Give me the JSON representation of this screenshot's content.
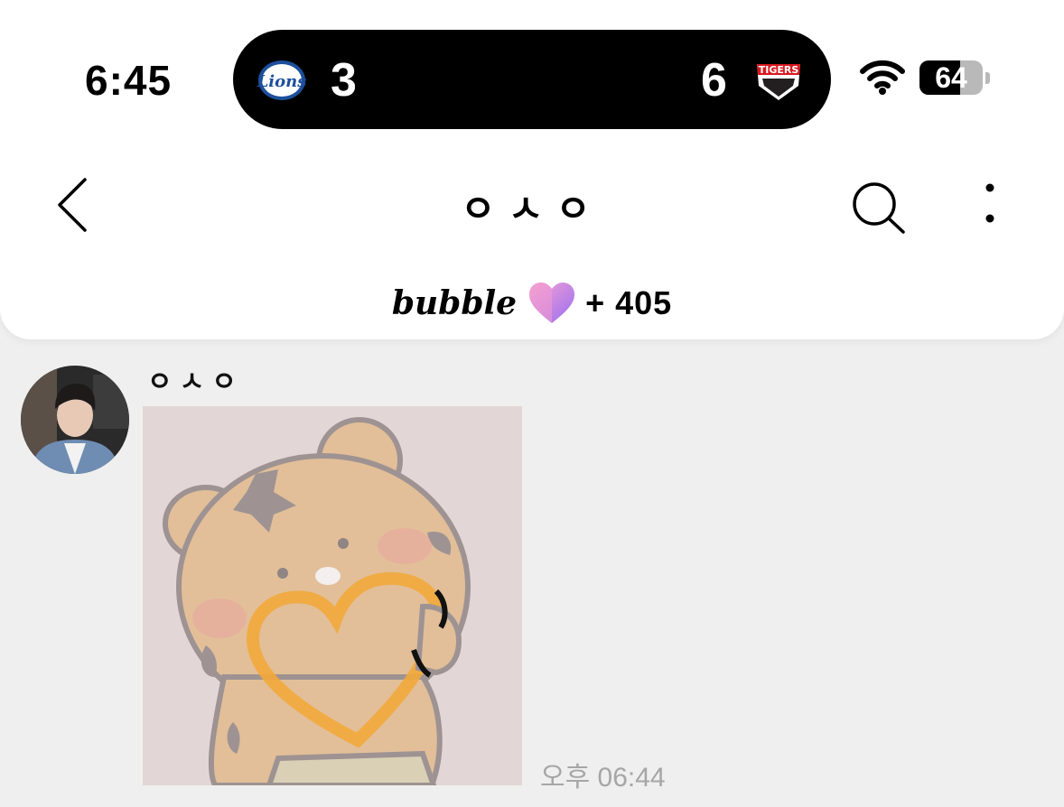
{
  "status_bar": {
    "time": "6:45",
    "live_activity": {
      "home_team_icon": "lions-logo-icon",
      "home_score": "3",
      "away_score": "6",
      "away_team_icon": "tigers-logo-icon"
    },
    "wifi_icon": "wifi-icon",
    "battery_level": "64",
    "battery_fraction": 0.64
  },
  "nav": {
    "back_icon": "chevron-left-icon",
    "title": "ㅇㅅㅇ",
    "search_icon": "search-icon",
    "more_icon": "vertical-ellipsis-icon"
  },
  "bubble_bar": {
    "brand": "bubble",
    "heart_icon": "gradient-heart-icon",
    "count": "+ 405"
  },
  "message": {
    "avatar_icon": "avatar",
    "sender": "ㅇㅅㅇ",
    "sticker": "tiger-heart-sticker",
    "time": "오후 06:44"
  },
  "colors": {
    "background": "#efefef",
    "header": "#ffffff",
    "island": "#000000",
    "timestamp": "#a6a6a6",
    "heart_pink": "#f49bd0",
    "heart_purple": "#9a6cf0"
  }
}
